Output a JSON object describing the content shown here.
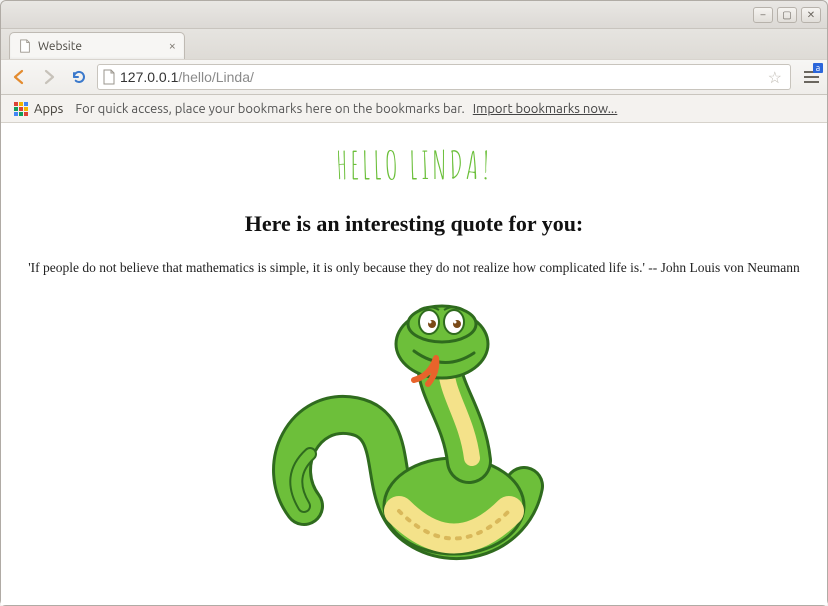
{
  "window": {
    "minimize_glyph": "–",
    "maximize_glyph": "▢",
    "close_glyph": "✕"
  },
  "tab": {
    "title": "Website",
    "close_glyph": "×"
  },
  "toolbar": {
    "address_host": "127.0.0.1",
    "address_path": "/hello/Linda/",
    "menu_badge": "a"
  },
  "bookmarks": {
    "apps_label": "Apps",
    "hint": "For quick access, place your bookmarks here on the bookmarks bar.",
    "import_link": "Import bookmarks now..."
  },
  "page": {
    "hello": "Hello Linda!",
    "subhead": "Here is an interesting quote for you:",
    "quote": "'If people do not believe that mathematics is simple, it is only because they do not realize how complicated life is.' -- John Louis von Neumann"
  },
  "icons": {
    "back": "back-icon",
    "forward": "forward-icon",
    "reload": "reload-icon",
    "page": "page-icon",
    "star": "star-icon",
    "menu": "hamburger-icon",
    "apps": "apps-grid-icon",
    "snake": "snake-illustration"
  }
}
